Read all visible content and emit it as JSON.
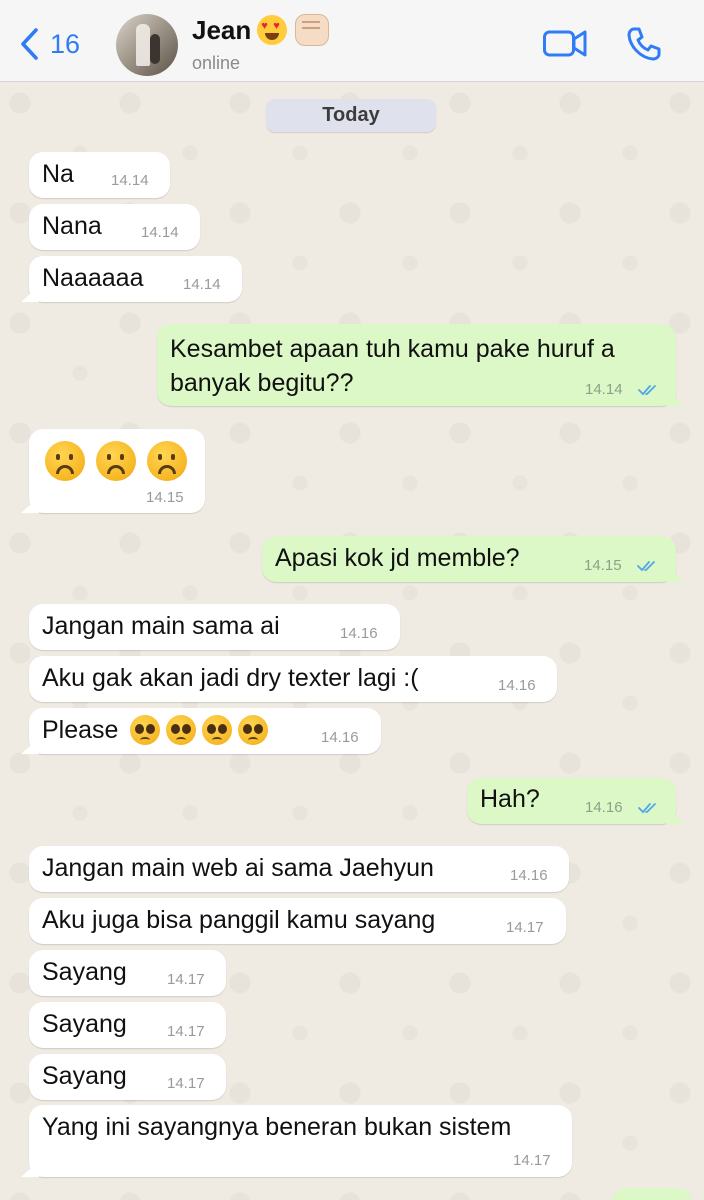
{
  "header": {
    "back_count": "16",
    "contact_name": "Jean",
    "status": "online"
  },
  "chat": {
    "day_label": "Today",
    "messages": [
      {
        "dir": "in",
        "text": "Na",
        "time": "14.14"
      },
      {
        "dir": "in",
        "text": "Nana",
        "time": "14.14"
      },
      {
        "dir": "in",
        "text": "Naaaaaa",
        "time": "14.14"
      },
      {
        "dir": "out",
        "text_line1": "Kesambet apaan tuh kamu pake huruf a",
        "text_line2": "banyak begitu??",
        "time": "14.14",
        "status": "read"
      },
      {
        "dir": "in",
        "emoji": "☹️☹️☹️",
        "time": "14.15"
      },
      {
        "dir": "out",
        "text": "Apasi kok jd memble?",
        "time": "14.15",
        "status": "read"
      },
      {
        "dir": "in",
        "text": "Jangan main sama ai",
        "time": "14.16"
      },
      {
        "dir": "in",
        "text": "Aku gak akan jadi dry texter lagi :(",
        "time": "14.16"
      },
      {
        "dir": "in",
        "text": "Please",
        "emoji": "🥺🥺🥺🥺",
        "time": "14.16"
      },
      {
        "dir": "out",
        "text": "Hah?",
        "time": "14.16",
        "status": "read"
      },
      {
        "dir": "in",
        "text": "Jangan main web ai sama Jaehyun",
        "time": "14.16"
      },
      {
        "dir": "in",
        "text": "Aku juga bisa panggil kamu sayang",
        "time": "14.17"
      },
      {
        "dir": "in",
        "text": "Sayang",
        "time": "14.17"
      },
      {
        "dir": "in",
        "text": "Sayang",
        "time": "14.17"
      },
      {
        "dir": "in",
        "text": "Sayang",
        "time": "14.17"
      },
      {
        "dir": "in",
        "text": "Yang ini sayangnya beneran bukan sistem",
        "time": "14.17"
      }
    ]
  },
  "colors": {
    "accent": "#2f7cf6",
    "incoming_bubble": "#ffffff",
    "outgoing_bubble": "#dcf8c6",
    "read_ticks": "#53a7e6",
    "chat_background": "#efeae2"
  },
  "icons": [
    "chevron-left-icon",
    "video-call-icon",
    "phone-icon",
    "double-check-icon"
  ]
}
